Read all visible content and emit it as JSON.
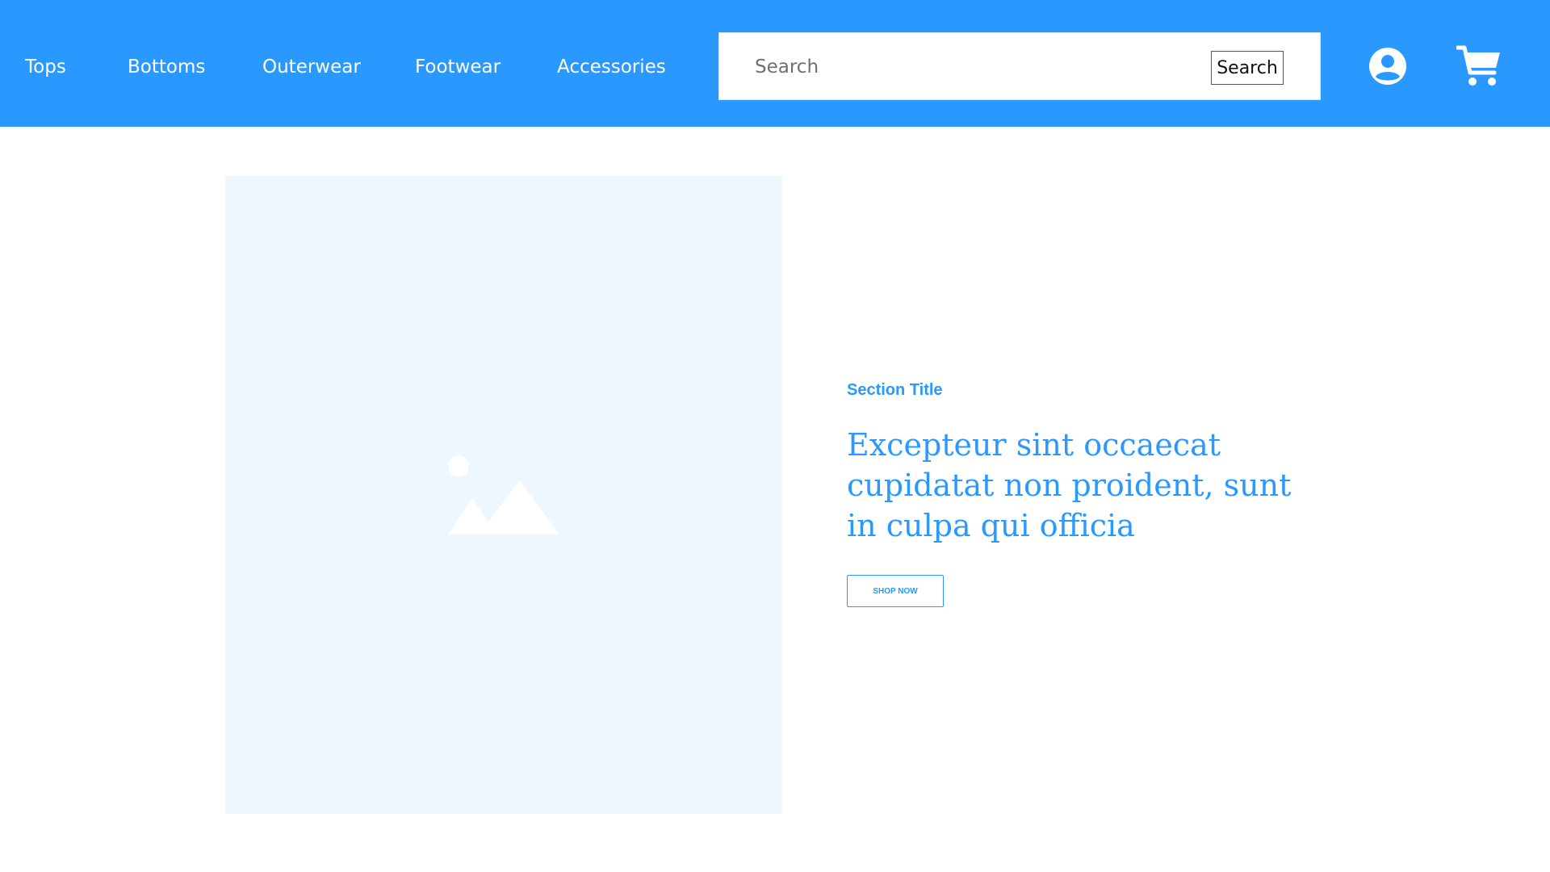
{
  "header": {
    "nav_items": [
      {
        "label": "Tops"
      },
      {
        "label": "Bottoms"
      },
      {
        "label": "Outerwear"
      },
      {
        "label": "Footwear"
      },
      {
        "label": "Accessories"
      }
    ],
    "search": {
      "placeholder": "Search",
      "value": "",
      "button_label": "Search"
    },
    "icons": {
      "account": "user-circle-icon",
      "cart": "shopping-cart-icon"
    }
  },
  "hero": {
    "image_icon": "image-placeholder-icon",
    "section_title": "Section Title",
    "headline": "Excepteur sint occaecat cupidatat non proident, sunt in culpa qui officia",
    "cta_label": "SHOP NOW"
  },
  "colors": {
    "primary": "#2999ff",
    "image_bg": "#eff7fe",
    "white": "#ffffff"
  }
}
